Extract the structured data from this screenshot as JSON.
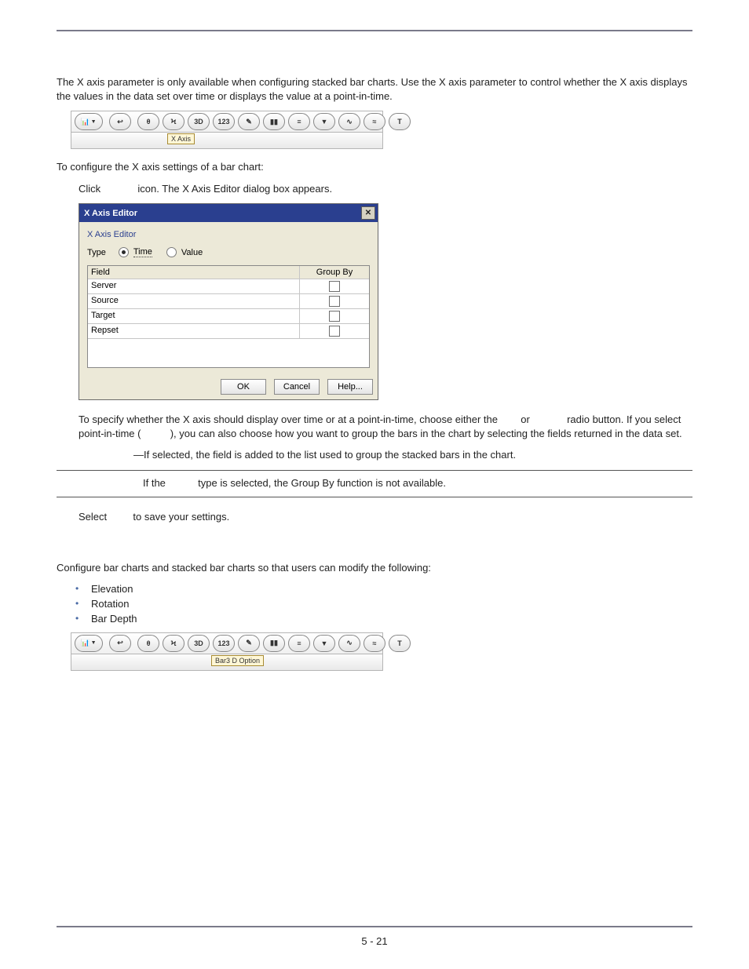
{
  "intro": "The X axis parameter is only available when configuring stacked bar charts. Use the X axis parameter to control whether the X axis displays the values in the data set over time or displays the value at a point-in-time.",
  "toolbar1": {
    "items": [
      "chart",
      "arrow",
      "theta",
      "xaxis",
      "3d",
      "n123",
      "wand",
      "bars",
      "list",
      "funnel",
      "squiggle",
      "dashes",
      "T"
    ],
    "label": "X Axis"
  },
  "configLine": "To configure the X axis settings of a bar chart:",
  "clickLine": {
    "a": "Click",
    "b": "icon. The X Axis Editor dialog box appears."
  },
  "dialog": {
    "title": "X Axis Editor",
    "subtitle": "X Axis Editor",
    "typeLabel": "Type",
    "timeLabel": "Time",
    "valueLabel": "Value",
    "headers": {
      "field": "Field",
      "group": "Group By"
    },
    "rows": [
      "Server",
      "Source",
      "Target",
      "Repset"
    ],
    "buttons": {
      "ok": "OK",
      "cancel": "Cancel",
      "help": "Help..."
    }
  },
  "timeValuePara": {
    "a": "To specify whether the X axis should display over time or at a point-in-time, choose either the",
    "b": "or",
    "c": "radio button. If you select point-in-time (",
    "d": "), you can also choose how you want to group the bars in the chart by selecting the fields returned in the data set."
  },
  "groupByLine": "—If selected, the field is added to the list used to group the stacked bars in the chart.",
  "noteLine": {
    "a": "If the",
    "b": "type is selected, the Group By function is not available."
  },
  "selectLine": {
    "a": "Select",
    "b": "to save your settings."
  },
  "barIntro": "Configure bar charts and stacked bar charts so that users can modify the following:",
  "bullets": [
    "Elevation",
    "Rotation",
    "Bar Depth"
  ],
  "toolbar2": {
    "label": "Bar3 D Option"
  },
  "pageNo": "5 - 21",
  "icons": {
    "3d": "3D",
    "n123": "123",
    "T": "T"
  }
}
